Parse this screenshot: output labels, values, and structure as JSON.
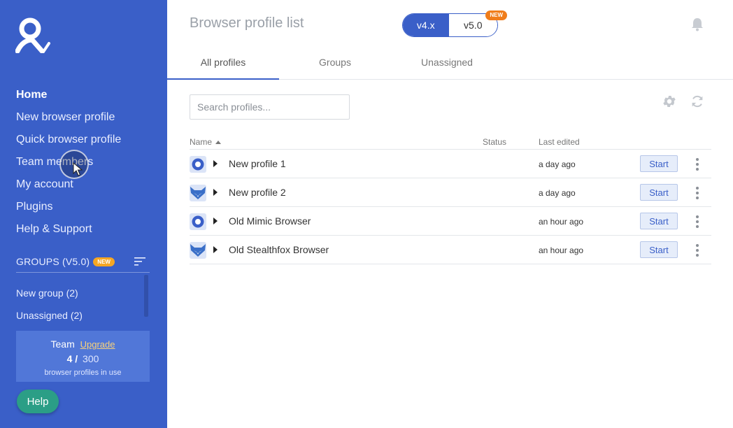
{
  "sidebar": {
    "nav": [
      {
        "label": "Home",
        "active": true
      },
      {
        "label": "New browser profile",
        "active": false
      },
      {
        "label": "Quick browser profile",
        "active": false
      },
      {
        "label": "Team members",
        "active": false
      },
      {
        "label": "My account",
        "active": false
      },
      {
        "label": "Plugins",
        "active": false
      },
      {
        "label": "Help & Support",
        "active": false
      }
    ],
    "groups_title": "GROUPS (V5.0)",
    "groups_new_badge": "NEW",
    "groups": [
      {
        "label": "New group (2)"
      },
      {
        "label": "Unassigned (2)"
      }
    ],
    "plan": {
      "name": "Team",
      "upgrade_label": "Upgrade",
      "used": "4 /",
      "total": "300",
      "caption": "browser profiles in use"
    },
    "help_label": "Help",
    "bg_color": "#3a5fc8"
  },
  "header": {
    "title": "Browser profile list",
    "versions": [
      {
        "label": "v4.x",
        "selected": true
      },
      {
        "label": "v5.0",
        "selected": false
      }
    ],
    "version_new_badge": "NEW",
    "icons": {
      "bell": "bell-icon"
    }
  },
  "tabs": [
    {
      "label": "All profiles",
      "active": true
    },
    {
      "label": "Groups",
      "active": false
    },
    {
      "label": "Unassigned",
      "active": false
    }
  ],
  "search": {
    "placeholder": "Search profiles...",
    "value": ""
  },
  "toolbar_icons": {
    "settings": "gear-icon",
    "refresh": "refresh-icon"
  },
  "table": {
    "columns": {
      "name": "Name",
      "status": "Status",
      "last_edited": "Last edited"
    },
    "sort": {
      "column": "Name",
      "direction": "asc"
    },
    "start_label": "Start",
    "rows": [
      {
        "browser": "mimic",
        "name": "New profile 1",
        "status": "",
        "last_edited": "a day ago"
      },
      {
        "browser": "stealthfox",
        "name": "New profile 2",
        "status": "",
        "last_edited": "a day ago"
      },
      {
        "browser": "mimic",
        "name": "Old Mimic Browser",
        "status": "",
        "last_edited": "an hour ago"
      },
      {
        "browser": "stealthfox",
        "name": "Old Stealthfox Browser",
        "status": "",
        "last_edited": "an hour ago"
      }
    ]
  },
  "colors": {
    "accent": "#3a5fc8",
    "new_badge": "#f5a623",
    "help_button": "#2b9e86"
  }
}
